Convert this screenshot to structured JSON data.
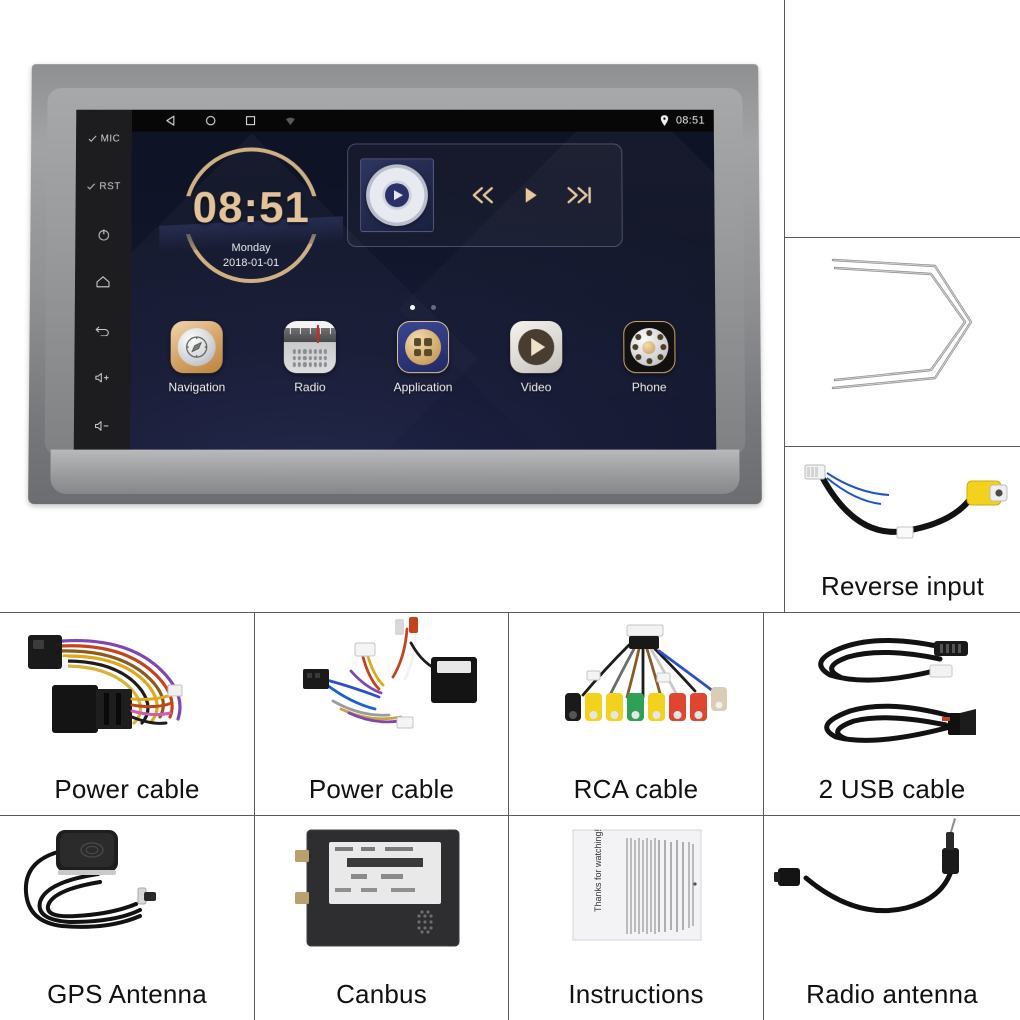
{
  "product": {
    "type": "car-stereo-head-unit-accessory-layout",
    "head_unit": {
      "status_bar": {
        "back_icon": "back-triangle-icon",
        "home_icon": "home-circle-icon",
        "recents_icon": "recents-square-icon",
        "signal_icon": "wifi-icon",
        "location_icon": "location-pin-icon",
        "time": "08:51"
      },
      "side_buttons": [
        {
          "id": "mic",
          "label": "MIC",
          "icon": "mic-check-icon"
        },
        {
          "id": "rst",
          "label": "RST",
          "icon": "reset-check-icon"
        },
        {
          "id": "power",
          "label": "",
          "icon": "power-icon"
        },
        {
          "id": "home",
          "label": "",
          "icon": "home-icon"
        },
        {
          "id": "back",
          "label": "",
          "icon": "back-arrow-icon"
        },
        {
          "id": "volume-up",
          "label": "",
          "icon": "volume-up-icon"
        },
        {
          "id": "volume-down",
          "label": "",
          "icon": "volume-down-icon"
        }
      ],
      "clock_widget": {
        "time": "08:51",
        "weekday": "Monday",
        "date": "2018-01-01",
        "accent_color": "#e3c49a"
      },
      "music_widget": {
        "album_icon": "cd-disc-icon",
        "play_overlay_icon": "play-icon",
        "previous_icon": "previous-track-icon",
        "play_icon": "play-icon",
        "next_icon": "next-track-icon",
        "control_color": "#e6c79c"
      },
      "page_dots": {
        "count": 2,
        "active_index": 0
      },
      "apps": [
        {
          "label": "Navigation",
          "icon": "compass-icon"
        },
        {
          "label": "Radio",
          "icon": "radio-icon"
        },
        {
          "label": "Application",
          "icon": "app-grid-icon"
        },
        {
          "label": "Video",
          "icon": "video-play-icon"
        },
        {
          "label": "Phone",
          "icon": "phone-dial-icon"
        }
      ]
    },
    "accessories": [
      {
        "id": "removal-keys",
        "label": "",
        "icon": "removal-keys-icon"
      },
      {
        "id": "reverse-input",
        "label": "Reverse input",
        "icon": "reverse-input-cable-icon"
      },
      {
        "id": "power-cable-1",
        "label": "Power cable",
        "icon": "power-harness-icon"
      },
      {
        "id": "power-cable-2",
        "label": "Power cable",
        "icon": "power-harness-iso-icon"
      },
      {
        "id": "rca-cable",
        "label": "RCA cable",
        "icon": "rca-cable-icon"
      },
      {
        "id": "usb-cable",
        "label": "2 USB cable",
        "icon": "usb-cable-icon"
      },
      {
        "id": "gps-antenna",
        "label": "GPS Antenna",
        "icon": "gps-antenna-icon"
      },
      {
        "id": "canbus",
        "label": "Canbus",
        "icon": "canbus-box-icon"
      },
      {
        "id": "instructions",
        "label": "Instructions",
        "icon": "manual-sheet-icon",
        "sheet_text": "Thanks for watching!"
      },
      {
        "id": "radio-antenna",
        "label": "Radio antenna",
        "icon": "radio-antenna-icon"
      }
    ],
    "colors": {
      "grid_border": "#5a5a5a",
      "background": "#ffffff",
      "bezel": "#909193",
      "screen": "#161a35",
      "gold_accent": "#e3c49a",
      "rca_yellow": "#f2d21c",
      "rca_green": "#2fa055",
      "rca_red": "#e0452f"
    }
  }
}
